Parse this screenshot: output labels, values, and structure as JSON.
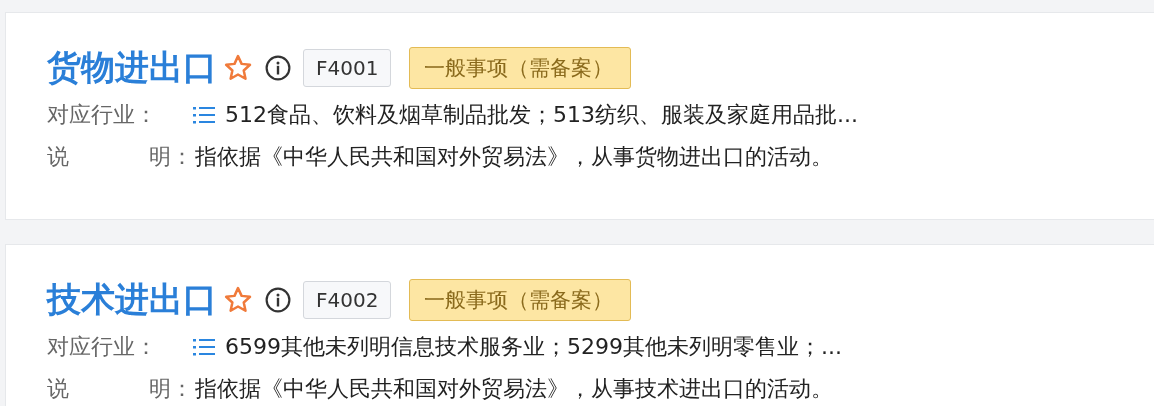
{
  "items": [
    {
      "title": "货物进出口",
      "code": "F4001",
      "tag": "一般事项（需备案）",
      "industry_label": "对应行业：",
      "industry": "512食品、饮料及烟草制品批发；513纺织、服装及家庭用品批...",
      "desc_label": [
        "说",
        "明："
      ],
      "desc": "指依据《中华人民共和国对外贸易法》，从事货物进出口的活动。"
    },
    {
      "title": "技术进出口",
      "code": "F4002",
      "tag": "一般事项（需备案）",
      "industry_label": "对应行业：",
      "industry": "6599其他未列明信息技术服务业；5299其他未列明零售业；...",
      "desc_label": [
        "说",
        "明："
      ],
      "desc": "指依据《中华人民共和国对外贸易法》，从事技术进出口的活动。"
    }
  ]
}
